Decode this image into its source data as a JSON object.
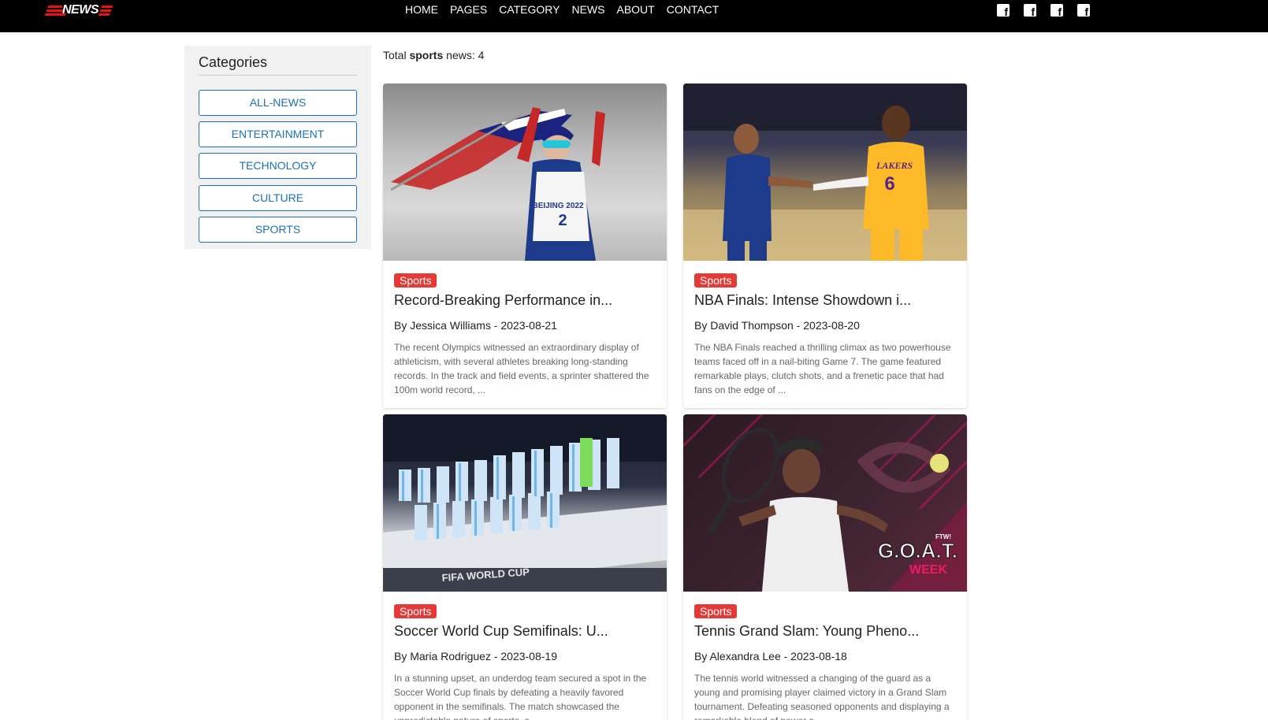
{
  "brand": {
    "logo_text": "NEWS",
    "accent": "#e11111"
  },
  "nav": {
    "links": [
      "HOME",
      "PAGES",
      "CATEGORY",
      "NEWS",
      "ABOUT",
      "CONTACT"
    ],
    "social_icons": [
      "facebook-icon",
      "facebook-icon",
      "facebook-icon",
      "facebook-icon"
    ]
  },
  "sidebar": {
    "title": "Categories",
    "categories": [
      "ALL-NEWS",
      "ENTERTAINMENT",
      "TECHNOLOGY",
      "CULTURE",
      "SPORTS"
    ]
  },
  "summary": {
    "prefix": "Total ",
    "category": "sports",
    "suffix": " news: 4"
  },
  "articles": [
    {
      "badge": "Sports",
      "title": "Record-Breaking Performance in...",
      "meta": "By Jessica Williams - 2023-08-21",
      "excerpt": "The recent Olympics witnessed an extraordinary display of athleticism, with several athletes breaking long-standing records. In the track and field events, a sprinter shattered the 100m world record, ..."
    },
    {
      "badge": "Sports",
      "title": "NBA Finals: Intense Showdown i...",
      "meta": "By David Thompson - 2023-08-20",
      "excerpt": "The NBA Finals reached a thrilling climax as two powerhouse teams faced off in a nail-biting Game 7. The game featured remarkable plays, clutch shots, and a frenetic pace that had fans on the edge of ..."
    },
    {
      "badge": "Sports",
      "title": "Soccer World Cup Semifinals: U...",
      "meta": "By Maria Rodriguez - 2023-08-19",
      "excerpt": "In a stunning upset, an underdog team secured a spot in the Soccer World Cup finals by defeating a heavily favored opponent in the semifinals. The match showcased the unpredictable nature of sports, a..."
    },
    {
      "badge": "Sports",
      "title": "Tennis Grand Slam: Young Pheno...",
      "meta": "By Alexandra Lee - 2023-08-18",
      "excerpt": "The tennis world witnessed a changing of the guard as a young and promising player claimed victory in a Grand Slam tournament. Defeating seasoned opponents and displaying a remarkable blend of power a..."
    }
  ],
  "image_text": {
    "olympic_bib": "BEIJING 2022",
    "bib_number": "2",
    "jersey_team": "LAKERS",
    "jersey_number": "6",
    "worldcup_banner": "FIFA WORLD CUP",
    "goat_small": "FTW!",
    "goat_big": "G.O.A.T.",
    "goat_week": "WEEK"
  }
}
